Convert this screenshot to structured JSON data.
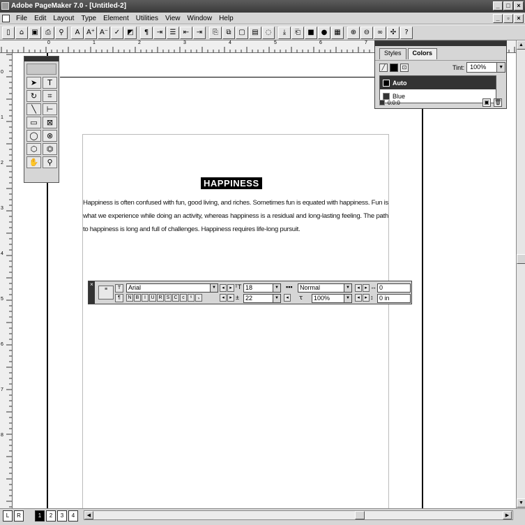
{
  "window": {
    "title": "Adobe PageMaker 7.0 - [Untitled-2]"
  },
  "menubar": {
    "items": [
      "File",
      "Edit",
      "Layout",
      "Type",
      "Element",
      "Utilities",
      "View",
      "Window",
      "Help"
    ]
  },
  "ruler": {
    "h_marks": [
      "0",
      "1",
      "2",
      "3",
      "4",
      "5",
      "6",
      "7"
    ],
    "v_marks": [
      "0",
      "1",
      "2",
      "3",
      "4",
      "5",
      "6",
      "7",
      "8"
    ]
  },
  "document": {
    "headline": "HAPPINESS",
    "body": "Happiness is often confused with fun, good living, and riches. Sometimes fun is equated with happiness. Fun is what we experience while doing an activity, whereas happiness is a residual and long-lasting feeling. The path to happiness is long and full of challenges. Happiness requires life-long pursuit."
  },
  "colors_panel": {
    "tabs": [
      "Styles",
      "Colors"
    ],
    "tint_label": "Tint:",
    "tint_value": "100%",
    "colors": [
      "Auto",
      "Blue"
    ],
    "footer_value": "0:0:0"
  },
  "control_palette": {
    "font": "Arial",
    "size": "18",
    "leading": "22",
    "style": "Normal",
    "scale": "100%",
    "kerning": "0",
    "indent": "0 in"
  },
  "pages": {
    "items": [
      "L",
      "R",
      "1",
      "2",
      "3",
      "4"
    ],
    "active": "1"
  }
}
